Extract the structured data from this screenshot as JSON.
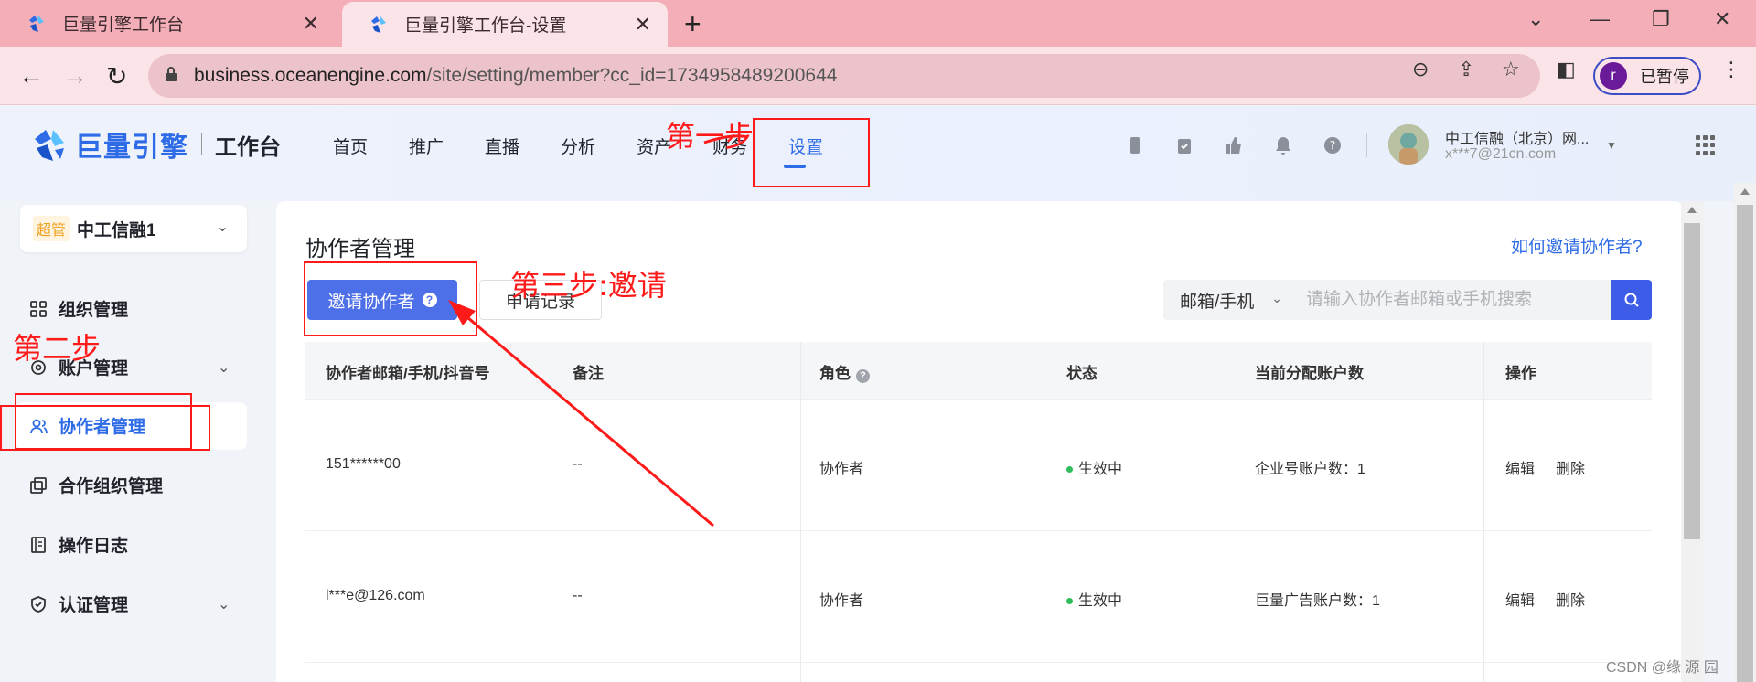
{
  "browser": {
    "tabs": [
      {
        "title": "巨量引擎工作台",
        "close": "✕"
      },
      {
        "title": "巨量引擎工作台-设置",
        "close": "✕"
      }
    ],
    "new_tab": "+",
    "url_host": "business.oceanengine.com",
    "url_path": "/site/setting/member?cc_id=1734958489200644",
    "profile_initial": "r",
    "profile_label": "已暂停"
  },
  "header": {
    "brand": "巨量引擎",
    "workspace": "工作台",
    "nav": [
      "首页",
      "推广",
      "直播",
      "分析",
      "资产",
      "财务",
      "设置"
    ],
    "active_nav": "设置",
    "user_name": "中工信融（北京）网...",
    "user_email": "x***7@21cn.com"
  },
  "sidebar": {
    "org_badge": "超管",
    "org_name": "中工信融1",
    "items": [
      {
        "label": "组织管理",
        "icon": "grid-icon"
      },
      {
        "label": "账户管理",
        "icon": "gear-icon",
        "expandable": true
      },
      {
        "label": "协作者管理",
        "icon": "users-icon",
        "active": true
      },
      {
        "label": "合作组织管理",
        "icon": "copy-icon"
      },
      {
        "label": "操作日志",
        "icon": "log-icon"
      },
      {
        "label": "认证管理",
        "icon": "shield-icon",
        "expandable": true
      }
    ]
  },
  "main": {
    "title": "协作者管理",
    "help_link": "如何邀请协作者?",
    "invite_button": "邀请协作者",
    "record_button": "申请记录",
    "search_type": "邮箱/手机",
    "search_placeholder": "请输入协作者邮箱或手机搜索",
    "columns": [
      "协作者邮箱/手机/抖音号",
      "备注",
      "角色",
      "状态",
      "当前分配账户数",
      "操作"
    ],
    "rows": [
      {
        "account": "151******00",
        "note": "--",
        "role": "协作者",
        "status": "生效中",
        "accounts": "企业号账户数：1",
        "edit": "编辑",
        "delete": "删除"
      },
      {
        "account": "l***e@126.com",
        "note": "--",
        "role": "协作者",
        "status": "生效中",
        "accounts": "巨量广告账户数：1",
        "edit": "编辑",
        "delete": "删除"
      }
    ]
  },
  "annotations": {
    "step1": "第一步",
    "step2": "第二步",
    "step3": "第三步:邀请",
    "color": "#ff1a1a"
  },
  "watermark": "CSDN @缘 源 园",
  "colors": {
    "accent": "#2e6be6",
    "button": "#4d6fe8",
    "status_green": "#2ebd59",
    "tabbar": "#f4aeb8"
  }
}
